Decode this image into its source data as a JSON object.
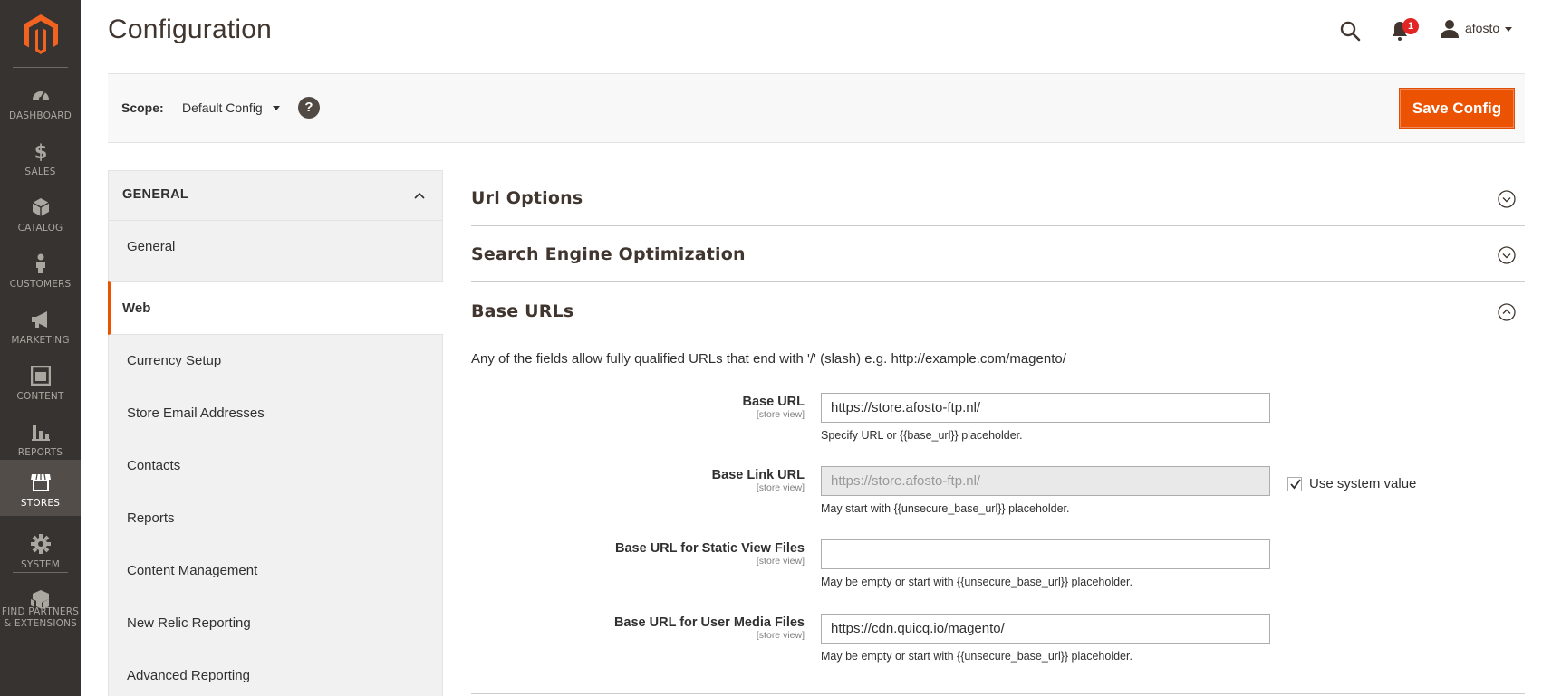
{
  "nav": {
    "items": [
      {
        "label": "DASHBOARD",
        "icon": "dashboard-icon"
      },
      {
        "label": "SALES",
        "icon": "dollar-icon"
      },
      {
        "label": "CATALOG",
        "icon": "cube-icon"
      },
      {
        "label": "CUSTOMERS",
        "icon": "person-icon"
      },
      {
        "label": "MARKETING",
        "icon": "megaphone-icon"
      },
      {
        "label": "CONTENT",
        "icon": "content-icon"
      },
      {
        "label": "REPORTS",
        "icon": "bar-chart-icon"
      },
      {
        "label": "STORES",
        "icon": "store-icon"
      },
      {
        "label": "SYSTEM",
        "icon": "gear-icon"
      },
      {
        "label": "FIND PARTNERS",
        "label2": "& EXTENSIONS",
        "icon": "boxes-icon"
      }
    ],
    "active": "STORES"
  },
  "header": {
    "title": "Configuration",
    "notifications_count": "1",
    "user_name": "afosto"
  },
  "scope": {
    "label": "Scope:",
    "value": "Default Config",
    "help": "?",
    "save_label": "Save Config"
  },
  "tabs": {
    "group_title": "GENERAL",
    "items": [
      "General",
      "Web",
      "Currency Setup",
      "Store Email Addresses",
      "Contacts",
      "Reports",
      "Content Management",
      "New Relic Reporting",
      "Advanced Reporting"
    ],
    "active": "Web"
  },
  "sections": {
    "url_options": "Url Options",
    "seo": "Search Engine Optimization",
    "base_urls": "Base URLs"
  },
  "base_urls": {
    "note": "Any of the fields allow fully qualified URLs that end with '/' (slash) e.g. http://example.com/magento/",
    "fields": [
      {
        "label": "Base URL",
        "scope": "[store view]",
        "value": "https://store.afosto-ftp.nl/",
        "hint": "Specify URL or {{base_url}} placeholder."
      },
      {
        "label": "Base Link URL",
        "scope": "[store view]",
        "value": "https://store.afosto-ftp.nl/",
        "hint": "May start with {{unsecure_base_url}} placeholder.",
        "use_system_value": "Use system value"
      },
      {
        "label": "Base URL for Static View Files",
        "scope": "[store view]",
        "value": "",
        "hint": "May be empty or start with {{unsecure_base_url}} placeholder."
      },
      {
        "label": "Base URL for User Media Files",
        "scope": "[store view]",
        "value": "https://cdn.quicq.io/magento/",
        "hint": "May be empty or start with {{unsecure_base_url}} placeholder."
      }
    ]
  },
  "colors": {
    "nav_bg": "#373330",
    "accent": "#eb5202",
    "badge": "#e22626"
  }
}
